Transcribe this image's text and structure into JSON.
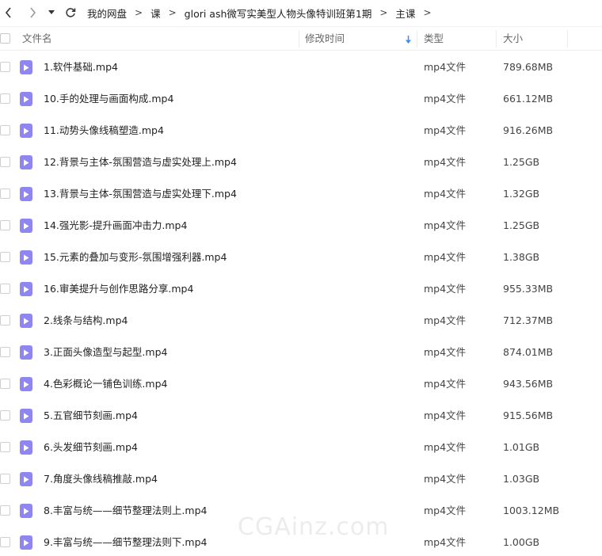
{
  "nav": {
    "back_icon": "chevron-left-icon",
    "forward_icon": "chevron-right-icon",
    "history_icon": "caret-down-icon",
    "refresh_icon": "refresh-icon"
  },
  "breadcrumb": [
    "我的网盘",
    "课",
    "glori ash微写实美型人物头像特训班第1期",
    "主课"
  ],
  "breadcrumb_separator": ">",
  "columns": {
    "name": "文件名",
    "modified": "修改时间",
    "type": "类型",
    "size": "大小"
  },
  "files": [
    {
      "name": "1.软件基础.mp4",
      "type": "mp4文件",
      "size": "789.68MB"
    },
    {
      "name": "10.手的处理与画面构成.mp4",
      "type": "mp4文件",
      "size": "661.12MB"
    },
    {
      "name": "11.动势头像线稿塑造.mp4",
      "type": "mp4文件",
      "size": "916.26MB"
    },
    {
      "name": "12.背景与主体-氛围营造与虚实处理上.mp4",
      "type": "mp4文件",
      "size": "1.25GB"
    },
    {
      "name": "13.背景与主体-氛围营造与虚实处理下.mp4",
      "type": "mp4文件",
      "size": "1.32GB"
    },
    {
      "name": "14.强光影-提升画面冲击力.mp4",
      "type": "mp4文件",
      "size": "1.25GB"
    },
    {
      "name": "15.元素的叠加与变形-氛围增强利器.mp4",
      "type": "mp4文件",
      "size": "1.38GB"
    },
    {
      "name": "16.审美提升与创作思路分享.mp4",
      "type": "mp4文件",
      "size": "955.33MB"
    },
    {
      "name": "2.线条与结构.mp4",
      "type": "mp4文件",
      "size": "712.37MB"
    },
    {
      "name": "3.正面头像造型与起型.mp4",
      "type": "mp4文件",
      "size": "874.01MB"
    },
    {
      "name": "4.色彩概论一铺色训练.mp4",
      "type": "mp4文件",
      "size": "943.56MB"
    },
    {
      "name": "5.五官细节刻画.mp4",
      "type": "mp4文件",
      "size": "915.56MB"
    },
    {
      "name": "6.头发细节刻画.mp4",
      "type": "mp4文件",
      "size": "1.01GB"
    },
    {
      "name": "7.角度头像线稿推敲.mp4",
      "type": "mp4文件",
      "size": "1.03GB"
    },
    {
      "name": "8.丰富与统——细节整理法则上.mp4",
      "type": "mp4文件",
      "size": "1003.12MB"
    },
    {
      "name": "9.丰富与统——细节整理法则下.mp4",
      "type": "mp4文件",
      "size": "1.00GB"
    }
  ],
  "file_icon": "video-file-icon",
  "watermark": "CGAinz.com",
  "colors": {
    "file_icon": "#8f86f2",
    "sort_arrow": "#3b8cf5"
  }
}
